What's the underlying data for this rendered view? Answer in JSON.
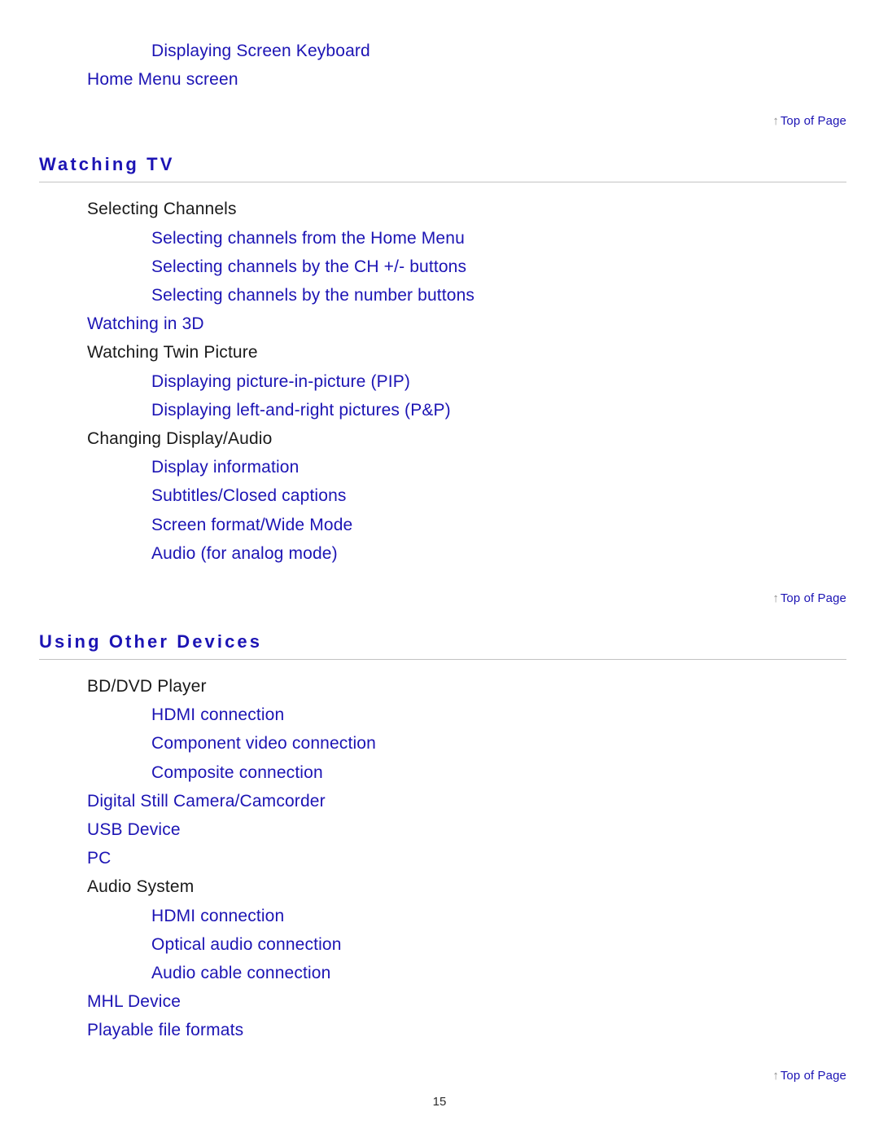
{
  "document": {
    "page_number": "15"
  },
  "intro": {
    "items": [
      {
        "label": "Displaying Screen Keyboard",
        "level": 2,
        "link": true
      },
      {
        "label": "Home Menu screen",
        "level": 1,
        "link": true
      }
    ]
  },
  "top_of_page": {
    "arrow_icon": "up-arrow-icon",
    "arrow_glyph": "↑",
    "label": "Top of Page",
    "arrow_color": "#8d8d8d",
    "label_color": "#1c14b4"
  },
  "sections": [
    {
      "id": "watching-tv",
      "title": "Watching TV",
      "items": [
        {
          "label": "Selecting Channels",
          "level": 1,
          "link": false
        },
        {
          "label": "Selecting channels from the Home Menu",
          "level": 2,
          "link": true
        },
        {
          "label": "Selecting channels by the CH +/- buttons",
          "level": 2,
          "link": true
        },
        {
          "label": "Selecting channels by the number buttons",
          "level": 2,
          "link": true
        },
        {
          "label": "Watching in 3D",
          "level": 1,
          "link": true
        },
        {
          "label": "Watching Twin Picture",
          "level": 1,
          "link": false
        },
        {
          "label": "Displaying picture-in-picture (PIP)",
          "level": 2,
          "link": true
        },
        {
          "label": "Displaying left-and-right pictures (P&P)",
          "level": 2,
          "link": true
        },
        {
          "label": "Changing Display/Audio",
          "level": 1,
          "link": false
        },
        {
          "label": "Display information",
          "level": 2,
          "link": true
        },
        {
          "label": "Subtitles/Closed captions",
          "level": 2,
          "link": true
        },
        {
          "label": "Screen format/Wide Mode",
          "level": 2,
          "link": true
        },
        {
          "label": "Audio (for analog mode)",
          "level": 2,
          "link": true
        }
      ]
    },
    {
      "id": "using-other-devices",
      "title": "Using Other Devices",
      "items": [
        {
          "label": "BD/DVD Player",
          "level": 1,
          "link": false
        },
        {
          "label": "HDMI connection",
          "level": 2,
          "link": true
        },
        {
          "label": "Component video connection",
          "level": 2,
          "link": true
        },
        {
          "label": "Composite connection",
          "level": 2,
          "link": true
        },
        {
          "label": "Digital Still Camera/Camcorder",
          "level": 1,
          "link": true
        },
        {
          "label": "USB Device",
          "level": 1,
          "link": true
        },
        {
          "label": "PC",
          "level": 1,
          "link": true
        },
        {
          "label": "Audio System",
          "level": 1,
          "link": false
        },
        {
          "label": "HDMI connection",
          "level": 2,
          "link": true
        },
        {
          "label": "Optical audio connection",
          "level": 2,
          "link": true
        },
        {
          "label": "Audio cable connection",
          "level": 2,
          "link": true
        },
        {
          "label": "MHL Device",
          "level": 1,
          "link": true
        },
        {
          "label": "Playable file formats",
          "level": 1,
          "link": true
        }
      ]
    }
  ],
  "colors": {
    "link": "#1c14b4",
    "heading": "#1c14b4",
    "text": "#1a1a1a",
    "rule": "#c3c3c3",
    "background": "#ffffff"
  }
}
